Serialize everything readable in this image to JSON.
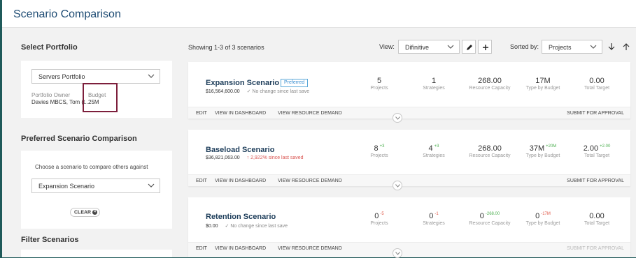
{
  "header": {
    "title": "Scenario Comparison"
  },
  "left": {
    "select_portfolio_title": "Select Portfolio",
    "portfolio_select_value": "Servers Portfolio",
    "owner_label": "Portfolio Owner",
    "owner_value": "Davies MBCS, Tom (t...",
    "budget_label": "Budget",
    "budget_value": "25M",
    "preferred_title": "Preferred Scenario Comparison",
    "preferred_hint": "Choose a scenario to compare others against",
    "preferred_select_value": "Expansion Scenario",
    "clear_label": "CLEAR",
    "filter_title": "Filter Scenarios"
  },
  "toolbar": {
    "showing_text": "Showing 1-3 of 3 scenarios",
    "view_label": "View:",
    "view_value": "Difinitive",
    "sorted_label": "Sorted by:",
    "sorted_value": "Projects"
  },
  "footer_links": {
    "edit": "EDIT",
    "dashboard": "VIEW IN DASHBOARD",
    "resource": "VIEW RESOURCE DEMAND",
    "submit": "SUBMIT FOR APPROVAL"
  },
  "scenarios": [
    {
      "name": "Expansion Scenario",
      "badge": "Preferred",
      "cost": "$16,564,600.00",
      "change_icon": "check",
      "change": "No change since last save",
      "projects": "5",
      "projects_delta": "",
      "strategies": "1",
      "strategies_delta": "",
      "capacity": "268.00",
      "capacity_delta": "",
      "budget": "17M",
      "budget_delta": "",
      "target": "0.00",
      "target_delta": ""
    },
    {
      "name": "Baseload Scenario",
      "badge": "",
      "cost": "$36,821,063.00",
      "change_icon": "↑",
      "change": "2,922% since last saved",
      "projects": "8",
      "projects_delta": "+3",
      "strategies": "4",
      "strategies_delta": "+3",
      "capacity": "268.00",
      "capacity_delta": "",
      "budget": "37M",
      "budget_delta": "+20M",
      "target": "2.00",
      "target_delta": "+2.00"
    },
    {
      "name": "Retention Scenario",
      "badge": "",
      "cost": "$0.00",
      "change_icon": "check",
      "change": "No change since last save",
      "projects": "0",
      "projects_delta": "-5",
      "strategies": "0",
      "strategies_delta": "-1",
      "capacity": "0",
      "capacity_delta": "-268.00",
      "budget": "0",
      "budget_delta": "-17M",
      "target": "0.00",
      "target_delta": ""
    }
  ],
  "metric_labels": {
    "projects": "Projects",
    "strategies": "Strategies",
    "capacity": "Resource Capacity",
    "budget": "Type by Budget",
    "target": "Total Target"
  },
  "colors": {
    "brand_title": "#1d4b73",
    "accent_blue": "#3b8fd0",
    "highlight_border": "#7d1f3c",
    "up_green": "#4caf50",
    "down_red": "#e05a4a"
  }
}
